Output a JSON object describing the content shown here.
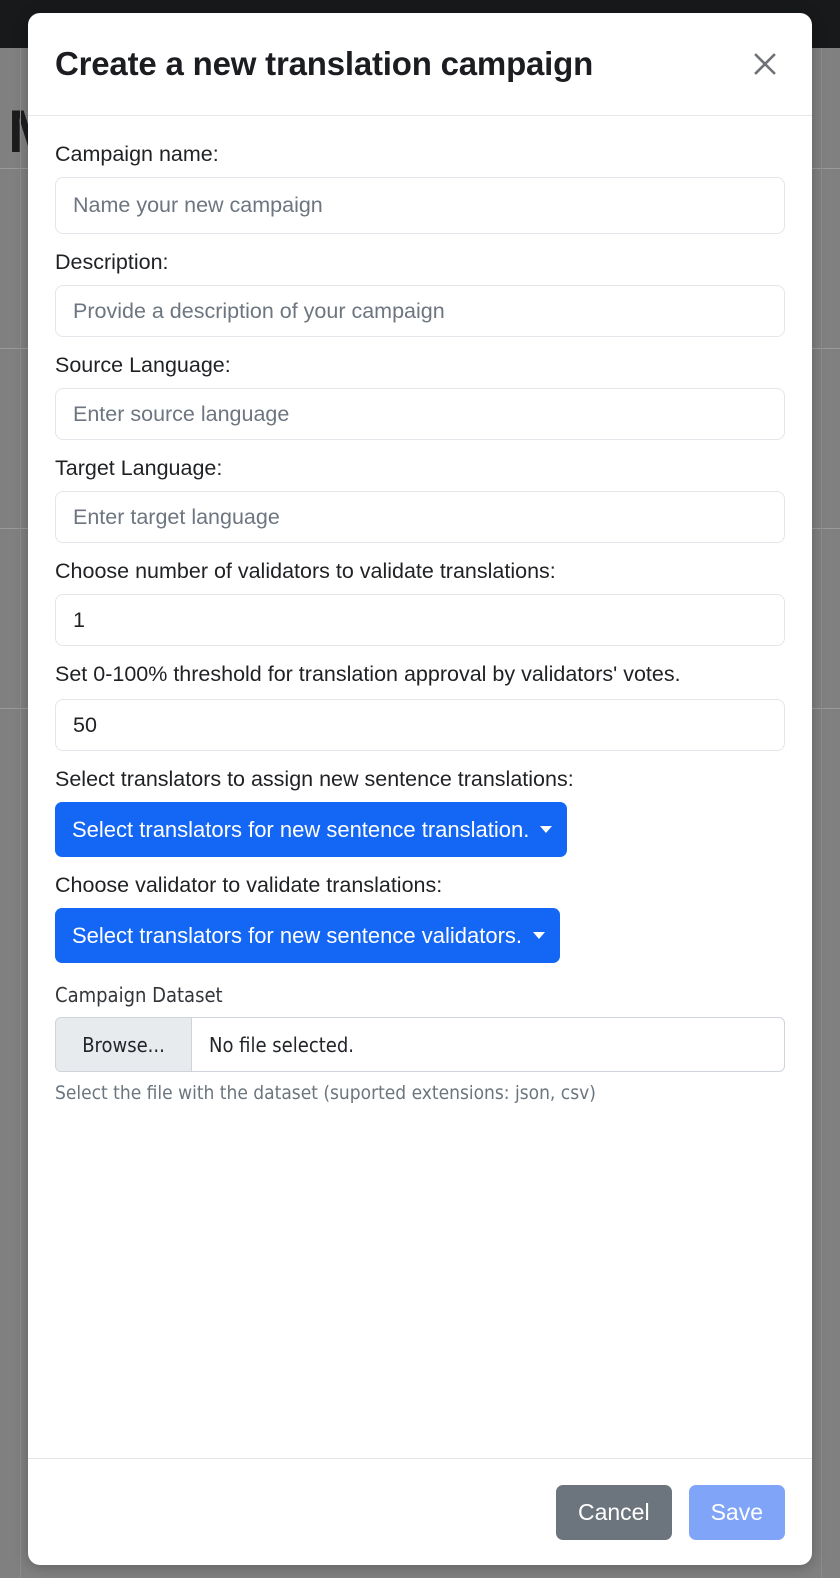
{
  "background": {
    "heading_text": "Manage campaigns",
    "navbar_color": "#18191a",
    "overlay_color": "#808080"
  },
  "modal": {
    "title": "Create a new translation campaign",
    "close_icon": "close-icon",
    "accent_color": "#1466f5",
    "fields": [
      {
        "id": "campaign-name",
        "label": "Campaign name:",
        "placeholder": "Name your new campaign",
        "value": ""
      },
      {
        "id": "description",
        "label": "Description:",
        "placeholder": "Provide a description of your campaign",
        "value": ""
      },
      {
        "id": "source-language",
        "label": "Source Language:",
        "placeholder": "Enter source language",
        "value": ""
      },
      {
        "id": "target-language",
        "label": "Target Language:",
        "placeholder": "Enter target language",
        "value": ""
      },
      {
        "id": "validator-count",
        "label": "Choose number of validators to validate translations:",
        "placeholder": "",
        "value": "1"
      },
      {
        "id": "approval-threshold",
        "label": "Set 0-100% threshold for translation approval by validators' votes.",
        "placeholder": "",
        "value": "50"
      }
    ],
    "dropdowns": [
      {
        "id": "translators",
        "label": "Select translators to assign new sentence translations:",
        "button_label": "Select translators for new sentence translation.",
        "caret_icon": "chevron-down-icon"
      },
      {
        "id": "validators",
        "label": "Choose validator to validate translations:",
        "button_label": "Select translators for new sentence validators.",
        "caret_icon": "chevron-down-icon"
      }
    ],
    "dataset": {
      "label": "Campaign Dataset",
      "browse_label": "Browse...",
      "file_status": "No file selected.",
      "help_text": "Select the file with the dataset (suported extensions: json, csv)"
    },
    "footer": {
      "cancel_label": "Cancel",
      "save_label": "Save",
      "cancel_color": "#6c757d",
      "save_color": "#80a5f8"
    }
  }
}
